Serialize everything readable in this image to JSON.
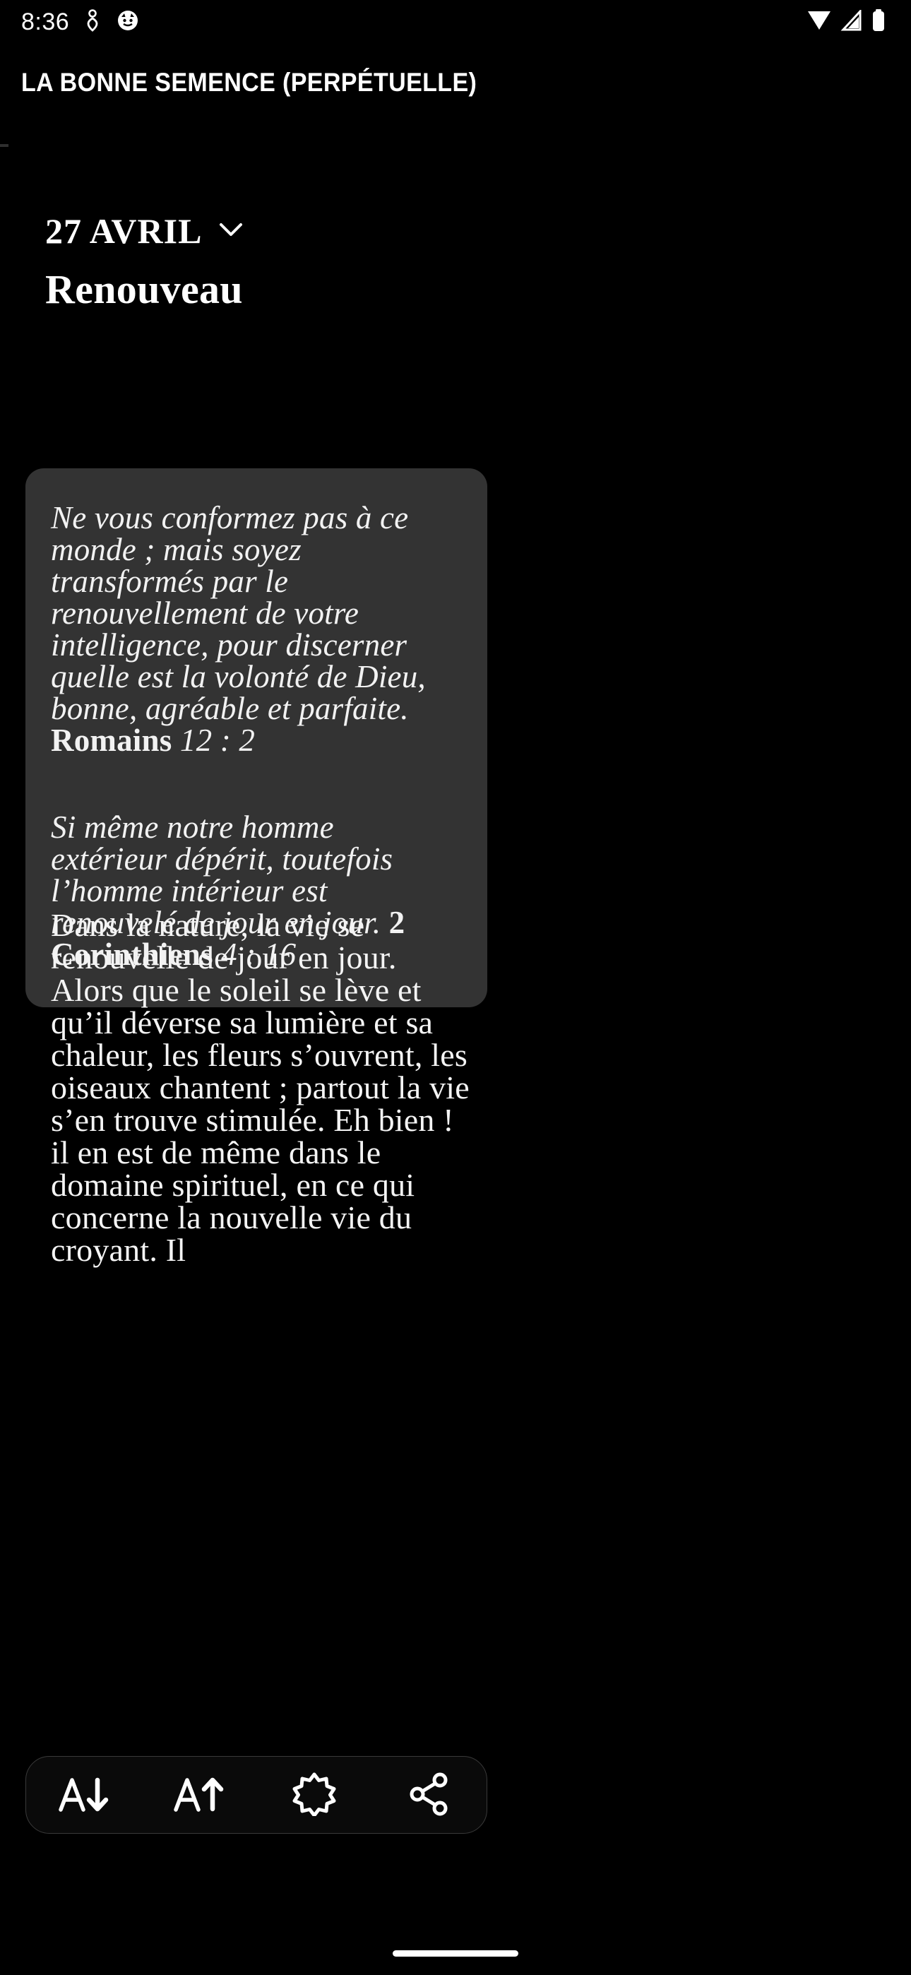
{
  "status_bar": {
    "time": "8:36",
    "left_icons": [
      "location-pin-icon",
      "app-notification-icon"
    ],
    "right_icons": [
      "wifi-icon",
      "cellular-signal-icon",
      "battery-icon"
    ]
  },
  "app_bar": {
    "title": "LA BONNE SEMENCE (PERPÉTUELLE)"
  },
  "reading": {
    "date": "27 AVRIL",
    "date_picker_icon": "chevron-down-icon",
    "day_title": "Renouveau",
    "verses": [
      {
        "text": "Ne vous conformez pas à ce monde ; mais soyez transformés par le renouvellement de votre intelligence, pour discerner quelle est la volonté de Dieu, bonne, agréable et parfaite. ",
        "reference": "Romains",
        "reference_tail": " 12 : 2"
      },
      {
        "text": "Si même notre homme extérieur dépérit, toutefois l’homme intérieur est renouvelé de jour en jour. ",
        "reference": "2 Corinthiens",
        "reference_tail": " 4 : 16"
      }
    ],
    "body": "Dans la nature, la vie se renouvelle de jour en jour. Alors que le soleil se lève et qu’il déverse sa lumière et sa chaleur, les fleurs s’ouvrent, les oiseaux chantent ; partout la vie s’en trouve stimulée. Eh bien ! il en est de même dans le domaine spirituel, en ce qui concerne la nouvelle vie du croyant. Il"
  },
  "toolbar": {
    "buttons": [
      {
        "name": "decrease-font-size-button",
        "icon": "font-size-decrease-icon",
        "label": "A↓"
      },
      {
        "name": "increase-font-size-button",
        "icon": "font-size-increase-icon",
        "label": "A↑"
      },
      {
        "name": "brightness-theme-button",
        "icon": "brightness-sun-icon",
        "label": ""
      },
      {
        "name": "share-button",
        "icon": "share-icon",
        "label": ""
      }
    ]
  },
  "colors": {
    "background": "#000000",
    "card_background": "#333333",
    "text_primary": "#f4f4f4",
    "toolbar_border": "#3a3a3a"
  }
}
